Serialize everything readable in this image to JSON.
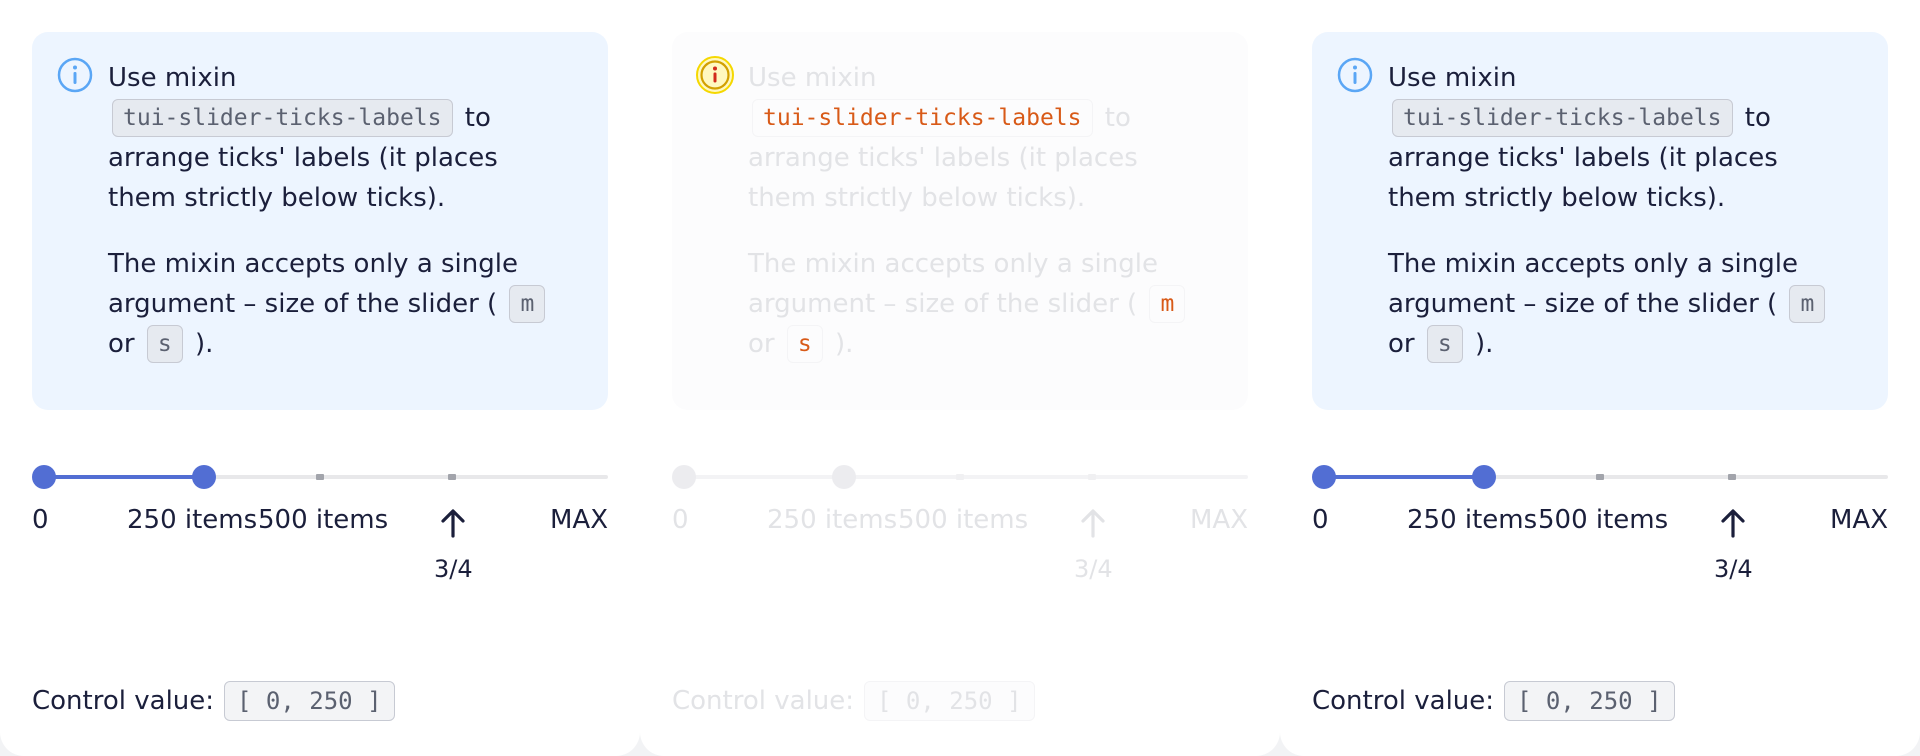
{
  "colors": {
    "accent": "#526ed3",
    "notice_bg": "#edf5ff",
    "text": "#1b1f3b",
    "icon_highlight": "#f5d800"
  },
  "columns": [
    {
      "state": "enabled",
      "icon": "info-icon",
      "notice": {
        "p1_before": "Use mixin",
        "p1_code": "tui-slider-ticks-labels",
        "p1_after": "to arrange ticks' labels (it places them strictly below ticks).",
        "p2_before": "The mixin accepts only a single argument – size of the slider (",
        "p2_code_m": "m",
        "p2_or": "or",
        "p2_code_s": "s",
        "p2_after": ")."
      },
      "slider": {
        "value": [
          0,
          250
        ],
        "labels": [
          "0",
          "250 items",
          "500 items",
          "MAX"
        ],
        "arrow_icon": "arrow-up-icon",
        "fraction": "3/4"
      },
      "control": {
        "label": "Control value:",
        "value": "[ 0, 250 ]"
      }
    },
    {
      "state": "disabled",
      "icon": "info-icon",
      "notice": {
        "p1_before": "Use mixin",
        "p1_code": "tui-slider-ticks-labels",
        "p1_after": "to arrange ticks' labels (it places them strictly below ticks).",
        "p2_before": "The mixin accepts only a single argument – size of the slider (",
        "p2_code_m": "m",
        "p2_or": "or",
        "p2_code_s": "s",
        "p2_after": ")."
      },
      "slider": {
        "value": [
          0,
          250
        ],
        "labels": [
          "0",
          "250 items",
          "500 items",
          "MAX"
        ],
        "arrow_icon": "arrow-up-icon",
        "fraction": "3/4"
      },
      "control": {
        "label": "Control value:",
        "value": "[ 0, 250 ]"
      }
    },
    {
      "state": "enabled",
      "icon": "info-icon",
      "notice": {
        "p1_before": "Use mixin",
        "p1_code": "tui-slider-ticks-labels",
        "p1_after": "to arrange ticks' labels (it places them strictly below ticks).",
        "p2_before": "The mixin accepts only a single argument – size of the slider (",
        "p2_code_m": "m",
        "p2_or": "or",
        "p2_code_s": "s",
        "p2_after": ")."
      },
      "slider": {
        "value": [
          0,
          250
        ],
        "labels": [
          "0",
          "250 items",
          "500 items",
          "MAX"
        ],
        "arrow_icon": "arrow-up-icon",
        "fraction": "3/4"
      },
      "control": {
        "label": "Control value:",
        "value": "[ 0, 250 ]"
      }
    }
  ]
}
